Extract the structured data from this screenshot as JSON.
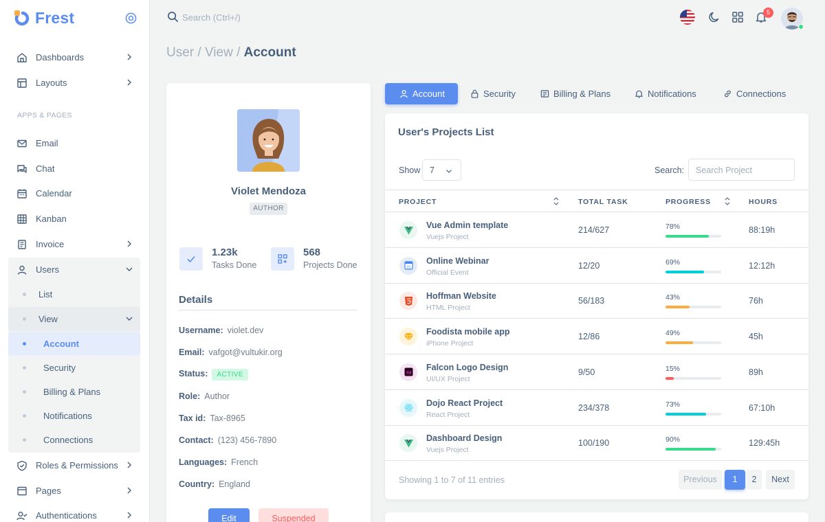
{
  "brand": {
    "name": "Frest"
  },
  "sidebar": {
    "section_label": "APPS & PAGES",
    "items": [
      {
        "label": "Dashboards",
        "icon": "home-icon"
      },
      {
        "label": "Layouts",
        "icon": "layout-icon"
      },
      {
        "label": "Email",
        "icon": "mail-icon"
      },
      {
        "label": "Chat",
        "icon": "chat-icon"
      },
      {
        "label": "Calendar",
        "icon": "calendar-icon"
      },
      {
        "label": "Kanban",
        "icon": "grid-icon"
      },
      {
        "label": "Invoice",
        "icon": "file-icon"
      },
      {
        "label": "Users",
        "icon": "user-icon"
      },
      {
        "label": "Roles & Permissions",
        "icon": "shield-icon"
      },
      {
        "label": "Pages",
        "icon": "browser-icon"
      },
      {
        "label": "Authentications",
        "icon": "user-check-icon"
      }
    ],
    "users_sub": {
      "list": "List",
      "view": "View",
      "view_sub": [
        "Account",
        "Security",
        "Billing & Plans",
        "Notifications",
        "Connections"
      ]
    }
  },
  "topbar": {
    "search_placeholder": "Search (Ctrl+/)",
    "notification_count": "5"
  },
  "breadcrumb": {
    "part1": "User / View / ",
    "current": "Account"
  },
  "profile": {
    "name": "Violet Mendoza",
    "role": "AUTHOR",
    "stats": [
      {
        "value": "1.23k",
        "label": "Tasks Done"
      },
      {
        "value": "568",
        "label": "Projects Done"
      }
    ],
    "details_title": "Details",
    "details": [
      {
        "key": "Username:",
        "value": "violet.dev"
      },
      {
        "key": "Email:",
        "value": "vafgot@vultukir.org"
      },
      {
        "key": "Status:",
        "value": "ACTIVE"
      },
      {
        "key": "Role:",
        "value": "Author"
      },
      {
        "key": "Tax id:",
        "value": "Tax-8965"
      },
      {
        "key": "Contact:",
        "value": "(123) 456-7890"
      },
      {
        "key": "Languages:",
        "value": "French"
      },
      {
        "key": "Country:",
        "value": "England"
      }
    ],
    "edit_label": "Edit",
    "suspend_label": "Suspended"
  },
  "tabs": [
    "Account",
    "Security",
    "Billing & Plans",
    "Notifications",
    "Connections"
  ],
  "projects": {
    "title": "User's Projects List",
    "show_label": "Show",
    "show_value": "7",
    "search_label": "Search:",
    "search_placeholder": "Search Project",
    "columns": [
      "PROJECT",
      "TOTAL TASK",
      "PROGRESS",
      "HOURS"
    ],
    "rows": [
      {
        "name": "Vue Admin template",
        "sub": "Vuejs Project",
        "task": "214/627",
        "progress": 78,
        "progress_label": "78%",
        "hours": "88:19h",
        "color": "#39da8a",
        "icon": "vue-icon"
      },
      {
        "name": "Online Webinar",
        "sub": "Official Event",
        "task": "12/20",
        "progress": 69,
        "progress_label": "69%",
        "hours": "12:12h",
        "color": "#00cfdd",
        "icon": "calendar-app-icon"
      },
      {
        "name": "Hoffman Website",
        "sub": "HTML Project",
        "task": "56/183",
        "progress": 43,
        "progress_label": "43%",
        "hours": "76h",
        "color": "#fdac41",
        "icon": "html5-icon"
      },
      {
        "name": "Foodista mobile app",
        "sub": "iPhone Project",
        "task": "12/86",
        "progress": 49,
        "progress_label": "49%",
        "hours": "45h",
        "color": "#fdac41",
        "icon": "sketch-icon"
      },
      {
        "name": "Falcon Logo Design",
        "sub": "UI/UX Project",
        "task": "9/50",
        "progress": 15,
        "progress_label": "15%",
        "hours": "89h",
        "color": "#ff5b5c",
        "icon": "xd-icon"
      },
      {
        "name": "Dojo React Project",
        "sub": "React Project",
        "task": "234/378",
        "progress": 73,
        "progress_label": "73%",
        "hours": "67:10h",
        "color": "#00cfdd",
        "icon": "react-icon"
      },
      {
        "name": "Dashboard Design",
        "sub": "Vuejs Project",
        "task": "100/190",
        "progress": 90,
        "progress_label": "90%",
        "hours": "129:45h",
        "color": "#39da8a",
        "icon": "vue-icon"
      }
    ],
    "footer_info": "Showing 1 to 7 of 11 entries",
    "pagination": {
      "previous": "Previous",
      "pages": [
        "1",
        "2"
      ],
      "next": "Next"
    }
  },
  "colors": {
    "primary": "#5a8dee",
    "success": "#39da8a",
    "danger": "#ff5b5c",
    "info": "#00cfdd",
    "warning": "#fdac41"
  }
}
